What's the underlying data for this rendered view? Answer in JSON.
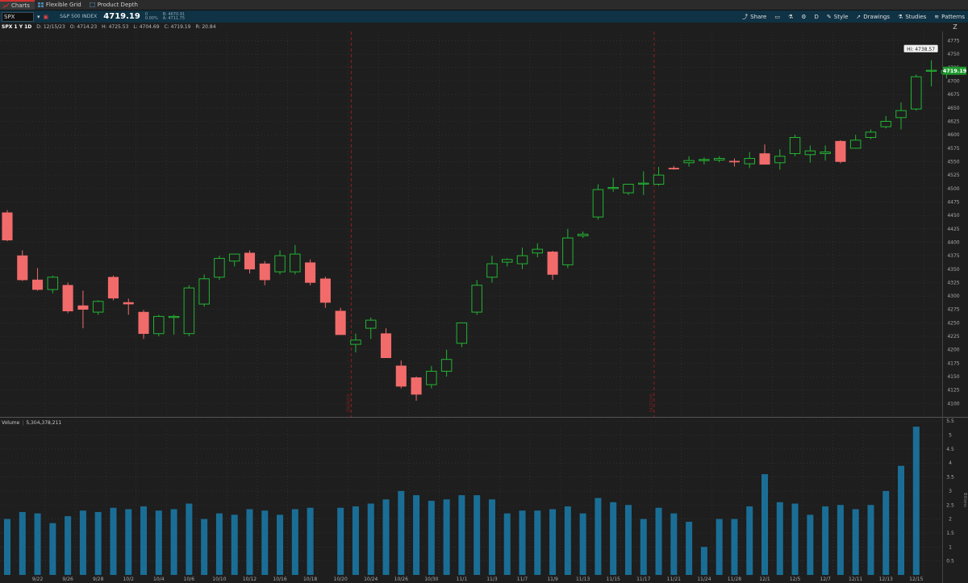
{
  "tabs": [
    {
      "label": "Charts",
      "icon": "chart-icon",
      "active": true
    },
    {
      "label": "Flexible Grid",
      "icon": "grid-icon",
      "active": false
    },
    {
      "label": "Product Depth",
      "icon": "depth-icon",
      "active": false
    }
  ],
  "symbol_bar": {
    "symbol": "SPX",
    "description": "S&P 500 INDEX",
    "last": "4719.19",
    "change": "0",
    "change_pct": "0.00%",
    "bid": "B: 4670.91",
    "ask": "A: 4711.75"
  },
  "toolbar": [
    {
      "label": "Share",
      "icon": "share-icon"
    },
    {
      "label": "",
      "icon": "save-icon"
    },
    {
      "label": "",
      "icon": "flask-icon"
    },
    {
      "label": "",
      "icon": "gear-icon"
    },
    {
      "label": "D",
      "icon": ""
    },
    {
      "label": "Style",
      "icon": "style-icon"
    },
    {
      "label": "Drawings",
      "icon": "cursor-icon"
    },
    {
      "label": "Studies",
      "icon": "studies-icon"
    },
    {
      "label": "Patterns",
      "icon": "patterns-icon"
    }
  ],
  "ohlc": {
    "title": "SPX 1 Y 1D",
    "date": "D: 12/15/23",
    "open": "O: 4714.23",
    "high": "H: 4725.53",
    "low": "L: 4704.69",
    "close": "C: 4719.19",
    "range": "R: 20.84"
  },
  "volume_header": {
    "label": "Volume",
    "value": "5,304,378,211"
  },
  "hi_label": "Hi: 4738.57",
  "last_price_label": "4719.19",
  "volume_axis_unit": "Billions",
  "colors": {
    "up": "#22b533",
    "down": "#f26b6b",
    "volume": "#1a6e96",
    "grid": "#3a3a3a",
    "bg": "#1e1e1e"
  },
  "chart_data": {
    "type": "candlestick",
    "price_ticks": [
      4100,
      4125,
      4150,
      4175,
      4200,
      4225,
      4250,
      4275,
      4300,
      4325,
      4350,
      4375,
      4400,
      4425,
      4450,
      4475,
      4500,
      4525,
      4550,
      4575,
      4600,
      4625,
      4650,
      4675,
      4700,
      4725,
      4750,
      4775
    ],
    "volume_ticks": [
      0.5,
      1,
      1.5,
      2,
      2.5,
      3,
      3.5,
      4,
      4.5,
      5,
      5.5
    ],
    "x_tick_labels": [
      {
        "i": 2,
        "label": "9/22"
      },
      {
        "i": 4,
        "label": "9/26"
      },
      {
        "i": 6,
        "label": "9/28"
      },
      {
        "i": 8,
        "label": "10/2"
      },
      {
        "i": 10,
        "label": "10/4"
      },
      {
        "i": 12,
        "label": "10/6"
      },
      {
        "i": 14,
        "label": "10/10"
      },
      {
        "i": 16,
        "label": "10/12"
      },
      {
        "i": 18,
        "label": "10/16"
      },
      {
        "i": 20,
        "label": "10/18"
      },
      {
        "i": 22,
        "label": "10/20"
      },
      {
        "i": 24,
        "label": "10/24"
      },
      {
        "i": 26,
        "label": "10/26"
      },
      {
        "i": 28,
        "label": "10/30"
      },
      {
        "i": 30,
        "label": "11/1"
      },
      {
        "i": 32,
        "label": "11/3"
      },
      {
        "i": 34,
        "label": "11/7"
      },
      {
        "i": 36,
        "label": "11/9"
      },
      {
        "i": 38,
        "label": "11/13"
      },
      {
        "i": 40,
        "label": "11/15"
      },
      {
        "i": 42,
        "label": "11/17"
      },
      {
        "i": 44,
        "label": "11/21"
      },
      {
        "i": 46,
        "label": "11/24"
      },
      {
        "i": 48,
        "label": "11/28"
      },
      {
        "i": 50,
        "label": "12/1"
      },
      {
        "i": 52,
        "label": "12/5"
      },
      {
        "i": 54,
        "label": "12/7"
      },
      {
        "i": 56,
        "label": "12/11"
      },
      {
        "i": 58,
        "label": "12/13"
      },
      {
        "i": 60,
        "label": "12/15"
      }
    ],
    "event_lines": [
      {
        "i": 22.7,
        "label": "10/20/23"
      },
      {
        "i": 42.7,
        "label": "11/17/23"
      }
    ],
    "candles": [
      [
        4455,
        4460,
        4402,
        4404
      ],
      [
        4375,
        4385,
        4328,
        4330
      ],
      [
        4330,
        4352,
        4310,
        4312
      ],
      [
        4312,
        4338,
        4305,
        4335
      ],
      [
        4320,
        4325,
        4268,
        4272
      ],
      [
        4282,
        4310,
        4240,
        4275
      ],
      [
        4270,
        4292,
        4265,
        4290
      ],
      [
        4335,
        4338,
        4292,
        4296
      ],
      [
        4288,
        4295,
        4265,
        4285
      ],
      [
        4270,
        4274,
        4220,
        4230
      ],
      [
        4230,
        4265,
        4225,
        4262
      ],
      [
        4260,
        4265,
        4228,
        4262
      ],
      [
        4230,
        4320,
        4225,
        4315
      ],
      [
        4285,
        4340,
        4280,
        4332
      ],
      [
        4335,
        4375,
        4330,
        4370
      ],
      [
        4365,
        4378,
        4355,
        4378
      ],
      [
        4380,
        4385,
        4342,
        4350
      ],
      [
        4360,
        4365,
        4320,
        4330
      ],
      [
        4345,
        4385,
        4340,
        4375
      ],
      [
        4345,
        4395,
        4340,
        4378
      ],
      [
        4362,
        4368,
        4320,
        4325
      ],
      [
        4332,
        4336,
        4278,
        4288
      ],
      [
        4272,
        4278,
        4232,
        4228
      ],
      [
        4210,
        4230,
        4195,
        4218
      ],
      [
        4240,
        4260,
        4220,
        4255
      ],
      [
        4230,
        4240,
        4190,
        4185
      ],
      [
        4170,
        4180,
        4128,
        4132
      ],
      [
        4148,
        4150,
        4105,
        4117
      ],
      [
        4135,
        4170,
        4128,
        4160
      ],
      [
        4160,
        4200,
        4150,
        4182
      ],
      [
        4212,
        4245,
        4205,
        4250
      ],
      [
        4270,
        4330,
        4265,
        4320
      ],
      [
        4335,
        4375,
        4325,
        4360
      ],
      [
        4363,
        4370,
        4355,
        4368
      ],
      [
        4360,
        4390,
        4350,
        4375
      ],
      [
        4380,
        4398,
        4372,
        4387
      ],
      [
        4382,
        4384,
        4330,
        4340
      ],
      [
        4358,
        4425,
        4352,
        4408
      ],
      [
        4412,
        4420,
        4408,
        4415
      ],
      [
        4447,
        4508,
        4442,
        4498
      ],
      [
        4500,
        4520,
        4494,
        4502
      ],
      [
        4492,
        4508,
        4488,
        4508
      ],
      [
        4510,
        4532,
        4488,
        4510
      ],
      [
        4508,
        4540,
        4505,
        4525
      ],
      [
        4538,
        4542,
        4535,
        4537
      ],
      [
        4548,
        4560,
        4541,
        4552
      ],
      [
        4552,
        4558,
        4545,
        4554
      ],
      [
        4553,
        4560,
        4549,
        4556
      ],
      [
        4551,
        4556,
        4541,
        4550
      ],
      [
        4546,
        4568,
        4538,
        4556
      ],
      [
        4565,
        4582,
        4545,
        4545
      ],
      [
        4548,
        4573,
        4535,
        4560
      ],
      [
        4565,
        4600,
        4560,
        4595
      ],
      [
        4563,
        4580,
        4548,
        4570
      ],
      [
        4565,
        4580,
        4552,
        4568
      ],
      [
        4588,
        4590,
        4547,
        4550
      ],
      [
        4575,
        4600,
        4574,
        4590
      ],
      [
        4595,
        4610,
        4592,
        4605
      ],
      [
        4615,
        4635,
        4612,
        4625
      ],
      [
        4632,
        4660,
        4610,
        4645
      ],
      [
        4648,
        4712,
        4645,
        4708
      ],
      [
        4720,
        4738.57,
        4690,
        4720
      ],
      [
        4714.23,
        4725.53,
        4704.69,
        4719.19
      ]
    ],
    "volume": [
      2.0,
      2.25,
      2.2,
      1.85,
      2.1,
      2.3,
      2.25,
      2.4,
      2.35,
      2.45,
      2.3,
      2.35,
      2.55,
      2.0,
      2.2,
      2.15,
      2.35,
      2.3,
      2.15,
      2.35,
      2.4,
      0,
      2.4,
      2.45,
      2.55,
      2.7,
      3.0,
      2.85,
      2.65,
      2.7,
      2.85,
      2.85,
      2.7,
      2.2,
      2.3,
      2.3,
      2.35,
      2.45,
      2.2,
      2.75,
      2.6,
      2.5,
      2.0,
      2.4,
      2.2,
      1.9,
      1.0,
      2.0,
      2.0,
      2.45,
      3.6,
      2.6,
      2.55,
      2.15,
      2.45,
      2.5,
      2.35,
      2.5,
      3.0,
      3.9,
      5.3
    ]
  }
}
